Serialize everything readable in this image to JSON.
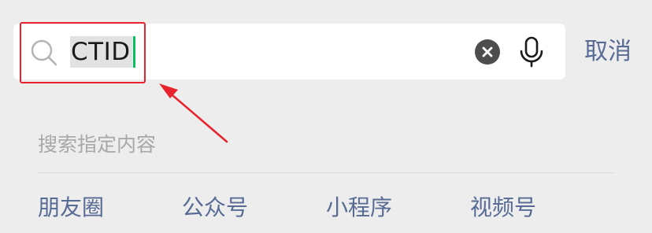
{
  "search": {
    "value": "CTID",
    "icons": {
      "search": "search-icon",
      "clear": "clear-icon",
      "voice": "microphone-icon"
    }
  },
  "cancel_label": "取消",
  "section_hint": "搜索指定内容",
  "categories": [
    {
      "label": "朋友圈"
    },
    {
      "label": "公众号"
    },
    {
      "label": "小程序"
    },
    {
      "label": "视频号"
    }
  ],
  "colors": {
    "background": "#ededed",
    "link": "#576b95",
    "caret": "#07c160",
    "annotation": "#e8232b",
    "hint_text": "#a8a8a8"
  }
}
